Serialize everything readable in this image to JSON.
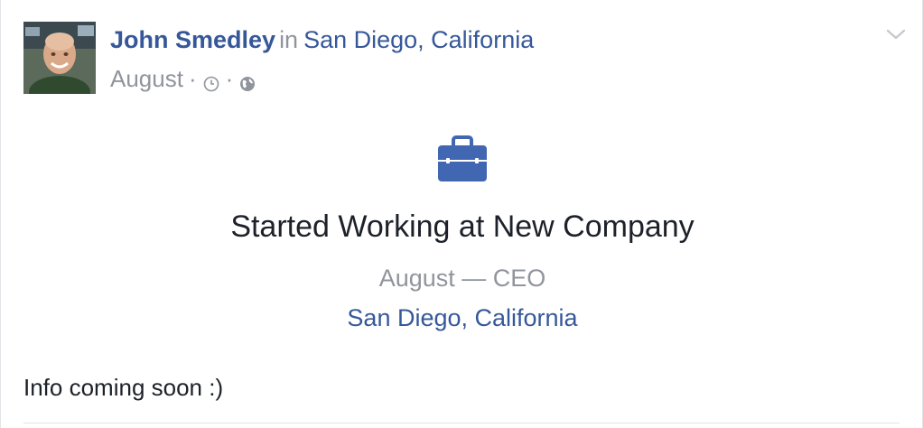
{
  "post": {
    "author": "John Smedley",
    "in_word": "in",
    "location": "San Diego, California",
    "date": "August",
    "separator": "·",
    "icons": {
      "avatar": "profile-photo",
      "time": "clock-icon",
      "privacy": "globe-icon",
      "menu": "chevron-down-icon"
    }
  },
  "life_event": {
    "icon": "briefcase-icon",
    "title": "Started Working at New Company",
    "subtitle": "August — CEO",
    "location": "San Diego, California"
  },
  "body_text": "Info coming soon :)",
  "colors": {
    "link": "#365899",
    "muted": "#90949c",
    "text": "#1d2129",
    "icon_blue": "#4267b2"
  }
}
